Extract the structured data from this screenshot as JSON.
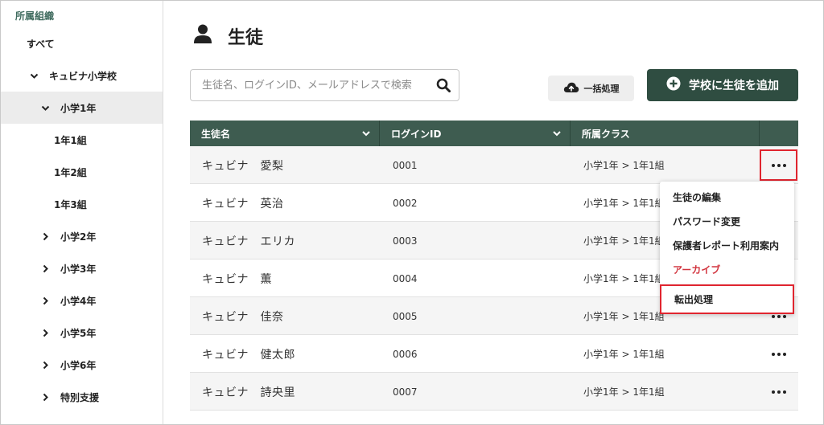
{
  "sidebar": {
    "title": "所属組織",
    "items": [
      {
        "label": "すべて",
        "chevron": "",
        "indent": 0,
        "active": false
      },
      {
        "label": "キュビナ小学校",
        "chevron": "down",
        "indent": 1,
        "active": false
      },
      {
        "label": "小学1年",
        "chevron": "down",
        "indent": 2,
        "active": true
      },
      {
        "label": "1年1組",
        "chevron": "",
        "indent": 3,
        "active": false
      },
      {
        "label": "1年2組",
        "chevron": "",
        "indent": 3,
        "active": false
      },
      {
        "label": "1年3組",
        "chevron": "",
        "indent": 3,
        "active": false
      },
      {
        "label": "小学2年",
        "chevron": "right",
        "indent": 2,
        "active": false
      },
      {
        "label": "小学3年",
        "chevron": "right",
        "indent": 2,
        "active": false
      },
      {
        "label": "小学4年",
        "chevron": "right",
        "indent": 2,
        "active": false
      },
      {
        "label": "小学5年",
        "chevron": "right",
        "indent": 2,
        "active": false
      },
      {
        "label": "小学6年",
        "chevron": "right",
        "indent": 2,
        "active": false
      },
      {
        "label": "特別支援",
        "chevron": "right",
        "indent": 2,
        "active": false
      }
    ]
  },
  "header": {
    "title": "生徒",
    "title_icon": "person-icon"
  },
  "search": {
    "placeholder": "生徒名、ログインID、メールアドレスで検索",
    "value": ""
  },
  "toolbar": {
    "bulk_label": "一括処理",
    "add_label": "学校に生徒を追加"
  },
  "table": {
    "columns": [
      "生徒名",
      "ログインID",
      "所属クラス",
      ""
    ],
    "rows": [
      {
        "name": "キュビナ　愛梨",
        "login": "0001",
        "class": "小学1年 >  1年1組"
      },
      {
        "name": "キュビナ　英治",
        "login": "0002",
        "class": "小学1年 >  1年1組"
      },
      {
        "name": "キュビナ　エリカ",
        "login": "0003",
        "class": "小学1年 >  1年1組"
      },
      {
        "name": "キュビナ　薫",
        "login": "0004",
        "class": "小学1年 >  1年1組"
      },
      {
        "name": "キュビナ　佳奈",
        "login": "0005",
        "class": "小学1年 >  1年1組"
      },
      {
        "name": "キュビナ　健太郎",
        "login": "0006",
        "class": "小学1年 >  1年1組"
      },
      {
        "name": "キュビナ　詩央里",
        "login": "0007",
        "class": "小学1年 >  1年1組"
      }
    ]
  },
  "menu": {
    "items": [
      {
        "label": "生徒の編集",
        "danger": false
      },
      {
        "label": "パスワード変更",
        "danger": false
      },
      {
        "label": "保護者レポート利用案内",
        "danger": false
      },
      {
        "label": "アーカイブ",
        "danger": true
      }
    ],
    "transfer_label": "転出処理"
  },
  "colors": {
    "accent": "#2f4d41",
    "header_bg": "#3e5c50",
    "danger": "#d2353f",
    "highlight": "#e0252f"
  }
}
